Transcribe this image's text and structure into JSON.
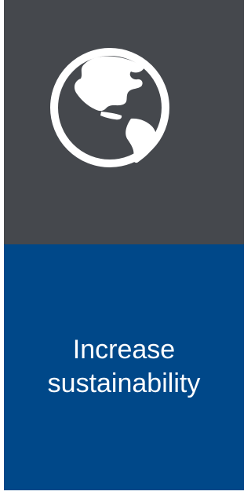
{
  "tile": {
    "icon": "globe-americas-icon",
    "caption_lines": [
      "Increase",
      "sustainability"
    ]
  },
  "colors": {
    "icon_panel_bg": "#45484d",
    "label_panel_bg": "#004889",
    "icon_color": "#ffffff",
    "text_color": "#ffffff"
  }
}
